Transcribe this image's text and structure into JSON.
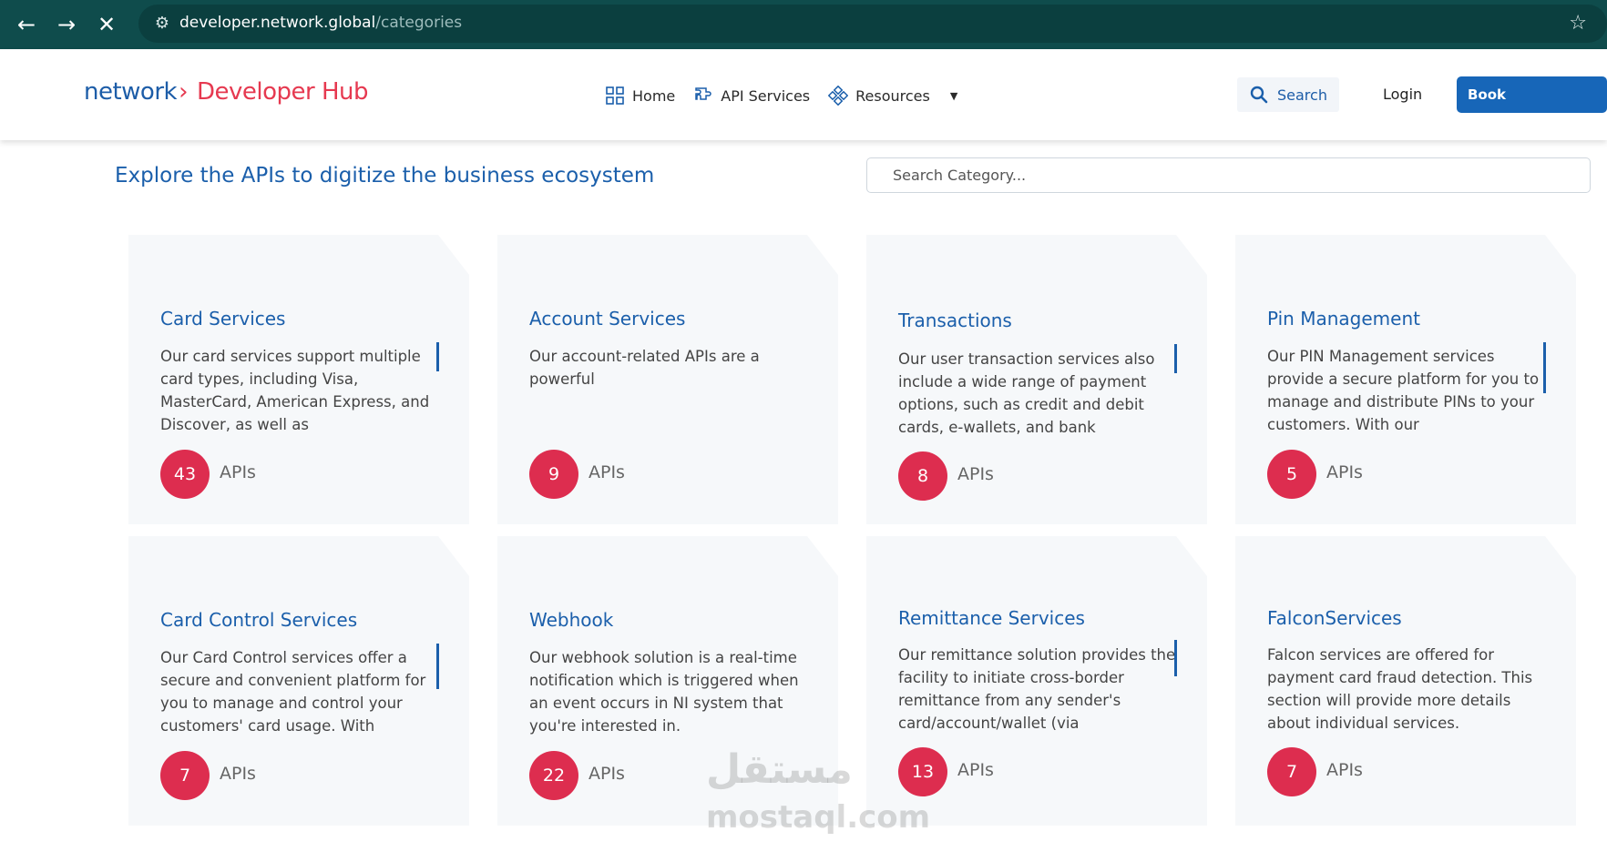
{
  "browser": {
    "url_host": "developer.network.global",
    "url_path": "/categories"
  },
  "header": {
    "logo_network": "network",
    "logo_arrow": "›",
    "logo_hub": "Developer Hub",
    "menu": [
      {
        "label": "Home",
        "icon": "grid-icon"
      },
      {
        "label": "API Services",
        "icon": "puzzle-icon"
      },
      {
        "label": "Resources",
        "icon": "diamond-nodes-icon"
      }
    ],
    "search_label": "Search",
    "login_label": "Login",
    "book_label": "Book Appointment"
  },
  "main": {
    "headline": "Explore the APIs to digitize the business ecosystem",
    "search_placeholder": "Search Category..."
  },
  "cards": [
    {
      "title": "Card Services",
      "desc": "Our card services support multiple card types, including Visa, MasterCard, American Express, and Discover, as well as",
      "count": "43",
      "label": "APIs"
    },
    {
      "title": "Account Services",
      "desc": "Our account-related APIs are a powerful",
      "count": "9",
      "label": "APIs"
    },
    {
      "title": "Transactions",
      "desc": "Our user transaction services also include a wide range of payment options, such as credit and debit cards, e-wallets, and bank",
      "count": "8",
      "label": "APIs"
    },
    {
      "title": "Pin Management",
      "desc": "Our PIN Management services provide a secure platform for you to manage and distribute PINs to your customers. With our",
      "count": "5",
      "label": "APIs"
    },
    {
      "title": "Card Control Services",
      "desc": "Our Card Control services offer a secure and convenient platform for you to manage and control your customers' card usage. With",
      "count": "7",
      "label": "APIs"
    },
    {
      "title": "Webhook",
      "desc": "Our webhook solution is a real-time notification which is triggered when an event occurs in NI system that you're interested in.",
      "count": "22",
      "label": "APIs"
    },
    {
      "title": "Remittance Services",
      "desc": "Our remittance solution provides the facility to initiate cross-border remittance from any sender's card/account/wallet (via",
      "count": "13",
      "label": "APIs"
    },
    {
      "title": "FalconServices",
      "desc": "Falcon services are offered for payment card fraud detection. This section will provide more details about individual services.",
      "count": "7",
      "label": "APIs"
    }
  ],
  "watermark": {
    "arabic": "مستقل",
    "latin": "mostaql.com"
  },
  "colors": {
    "accent": "#1b5fab",
    "badge": "#dd2d4f",
    "chrome": "#0f4c4c"
  }
}
